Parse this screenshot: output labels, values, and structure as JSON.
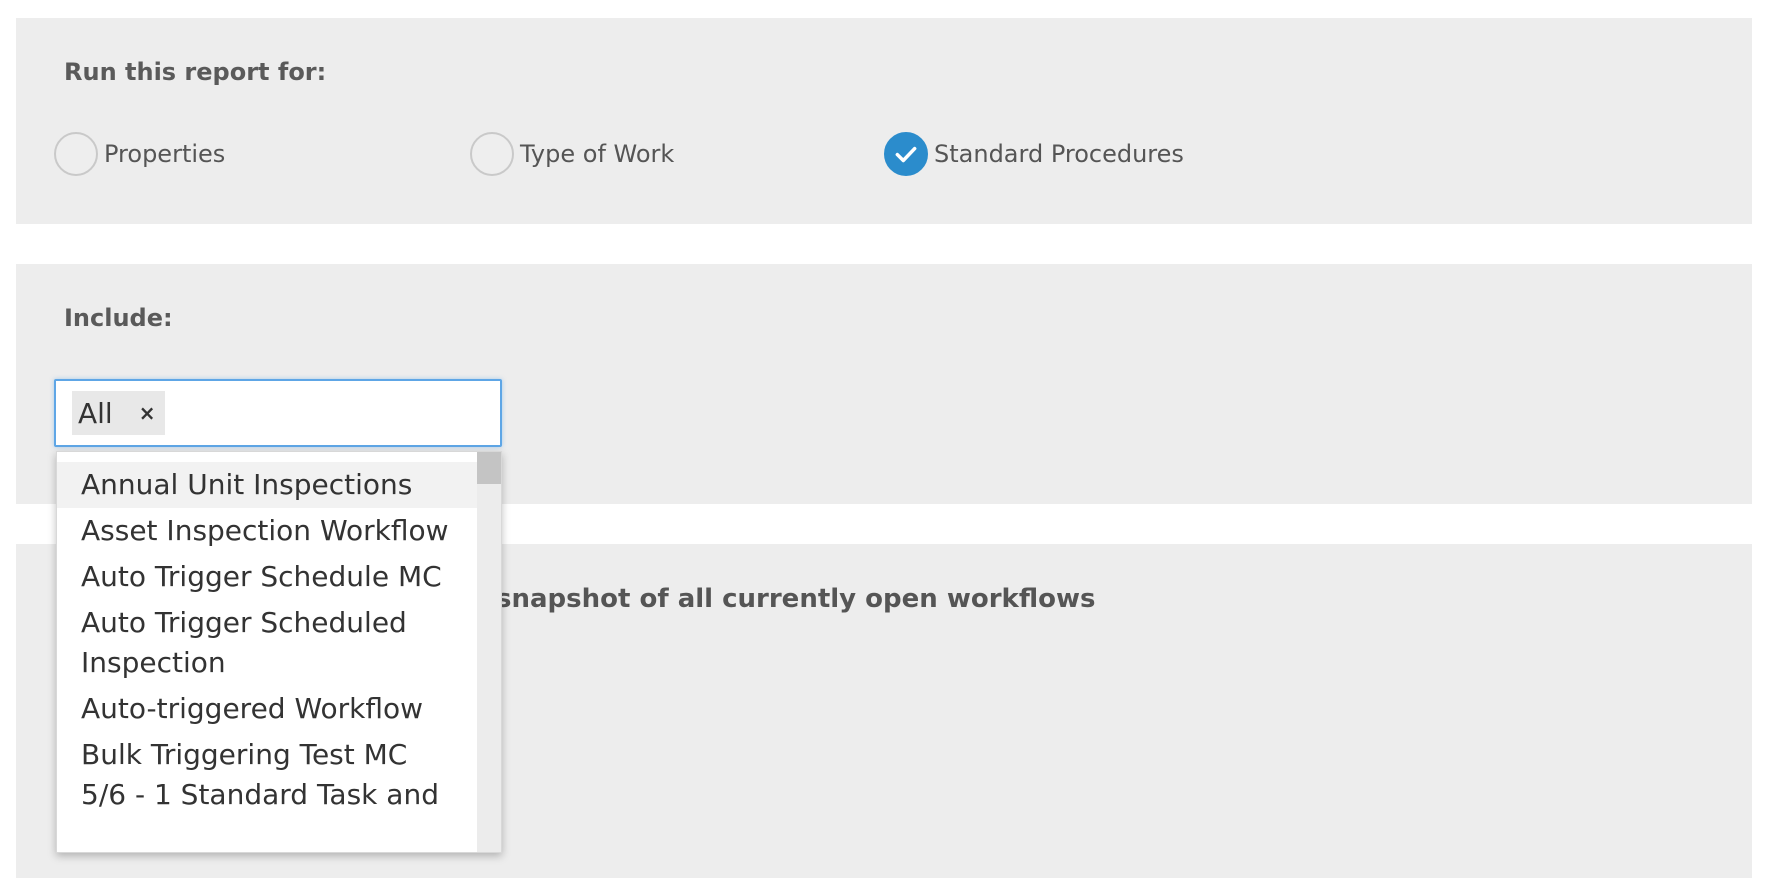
{
  "run_report": {
    "label": "Run this report for:",
    "options": [
      {
        "label": "Properties",
        "checked": false
      },
      {
        "label": "Type of Work",
        "checked": false
      },
      {
        "label": "Standard Procedures",
        "checked": true
      }
    ]
  },
  "include": {
    "label": "Include:",
    "selected_tag": "All",
    "remove_glyph": "×",
    "dropdown_options": [
      "Annual Unit Inspections",
      "Asset Inspection Workflow",
      "Auto Trigger Schedule MC",
      "Auto Trigger Scheduled Inspection",
      "Auto-triggered Workflow",
      "Bulk Triggering Test MC 5/6 - 1 Standard Task and"
    ]
  },
  "snapshot": {
    "text": "snapshot of all currently open workflows"
  },
  "colors": {
    "accent": "#2b8ccc",
    "focus_border": "#5ea6e6",
    "panel_bg": "#ededed"
  },
  "icons": {
    "checked": "check-icon",
    "remove": "remove-x-icon"
  }
}
